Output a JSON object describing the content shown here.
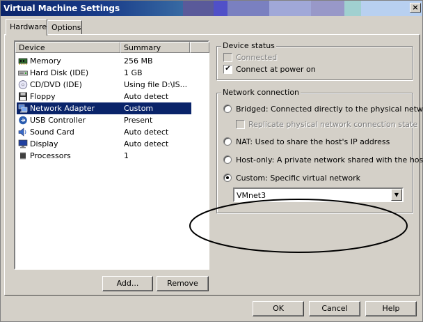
{
  "window": {
    "title": "Virtual Machine Settings",
    "close_glyph": "×"
  },
  "tabs": [
    {
      "label": "Hardware",
      "active": true
    },
    {
      "label": "Options",
      "active": false
    }
  ],
  "device_list": {
    "columns": [
      "Device",
      "Summary"
    ],
    "rows": [
      {
        "icon": "memory-icon",
        "device": "Memory",
        "summary": "256 MB"
      },
      {
        "icon": "hard-disk-icon",
        "device": "Hard Disk (IDE)",
        "summary": "1 GB"
      },
      {
        "icon": "cd-dvd-icon",
        "device": "CD/DVD (IDE)",
        "summary": "Using file D:\\IS..."
      },
      {
        "icon": "floppy-icon",
        "device": "Floppy",
        "summary": "Auto detect"
      },
      {
        "icon": "network-adapter-icon",
        "device": "Network Adapter",
        "summary": "Custom",
        "selected": true
      },
      {
        "icon": "usb-icon",
        "device": "USB Controller",
        "summary": "Present"
      },
      {
        "icon": "sound-card-icon",
        "device": "Sound Card",
        "summary": "Auto detect"
      },
      {
        "icon": "display-icon",
        "device": "Display",
        "summary": "Auto detect"
      },
      {
        "icon": "processor-icon",
        "device": "Processors",
        "summary": "1"
      }
    ]
  },
  "buttons": {
    "add": "Add...",
    "remove": "Remove",
    "ok": "OK",
    "cancel": "Cancel",
    "help": "Help"
  },
  "device_status": {
    "title": "Device status",
    "connected": {
      "label": "Connected",
      "checked": false,
      "enabled": false
    },
    "connect_at_power_on": {
      "label": "Connect at power on",
      "checked": true
    }
  },
  "network_connection": {
    "title": "Network connection",
    "bridged": "Bridged: Connected directly to the physical network",
    "replicate": "Replicate physical network connection state",
    "nat": "NAT: Used to share the host's IP address",
    "host_only": "Host-only: A private network shared with the host",
    "custom": "Custom: Specific virtual network",
    "selected": "custom",
    "custom_network_value": "VMnet3"
  },
  "colors": {
    "selection": "#0a246a",
    "face": "#d4d0c8"
  }
}
